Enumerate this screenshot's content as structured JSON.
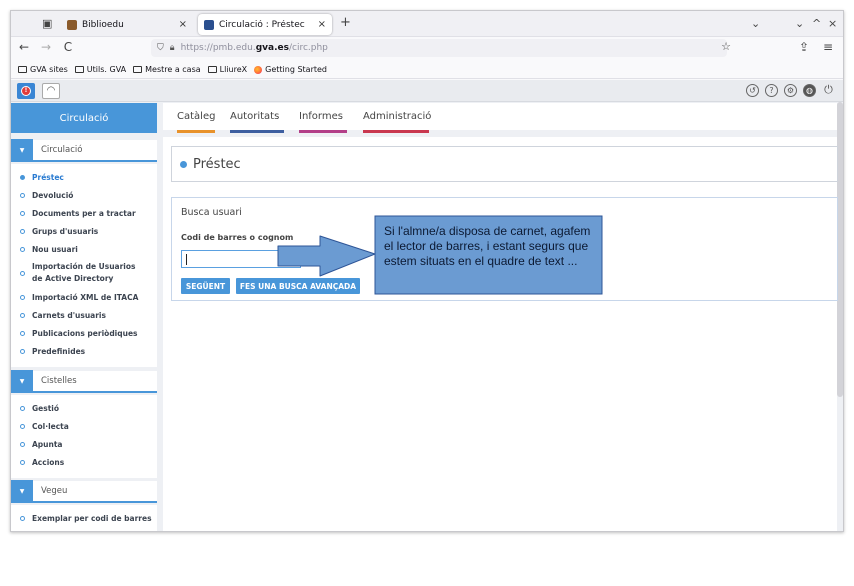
{
  "browser": {
    "tabs": [
      {
        "title": "Biblioedu",
        "close": "×"
      },
      {
        "title": "Circulació : Préstec",
        "close": "×"
      }
    ],
    "new_tab": "+",
    "window_controls": [
      "⌄",
      "⌄",
      "^",
      "×"
    ],
    "nav": {
      "back": "←",
      "forward": "→",
      "reload": "C"
    },
    "url": {
      "prefix": "https://pmb.edu.",
      "domain": "gva.es",
      "path": "/circ.php"
    },
    "bookmarks": [
      "GVA sites",
      "Utils. GVA",
      "Mestre a casa",
      "LliureX",
      "Getting Started"
    ]
  },
  "toolbar": {
    "alert_badge": "!",
    "right_icons": [
      "history-icon",
      "help-icon",
      "gear-icon",
      "globe-icon",
      "power-icon"
    ]
  },
  "sidebar": {
    "title": "Circulació",
    "sections": [
      {
        "header": "Circulació",
        "items": [
          {
            "label": "Préstec",
            "active": true
          },
          {
            "label": "Devolució"
          },
          {
            "label": "Documents per a tractar"
          },
          {
            "label": "Grups d'usuaris"
          },
          {
            "label": "Nou usuari"
          },
          {
            "label": "Importación de Usuarios de Active Directory"
          },
          {
            "label": "Importació XML de ITACA"
          },
          {
            "label": "Carnets d'usuaris"
          },
          {
            "label": "Publicacions periòdiques"
          },
          {
            "label": "Predefinides"
          }
        ]
      },
      {
        "header": "Cistelles",
        "items": [
          {
            "label": "Gestió"
          },
          {
            "label": "Col·lecta"
          },
          {
            "label": "Apunta"
          },
          {
            "label": "Accions"
          }
        ]
      },
      {
        "header": "Vegeu",
        "items": [
          {
            "label": "Exemplar per codi de barres"
          }
        ]
      }
    ]
  },
  "main": {
    "tabs": [
      {
        "label": "Catàleg",
        "color": "#e8922b"
      },
      {
        "label": "Autoritats",
        "color": "#3e5fa0"
      },
      {
        "label": "Informes",
        "color": "#b33f88"
      },
      {
        "label": "Administració",
        "color": "#c9384f"
      }
    ],
    "title": "Préstec",
    "search": {
      "heading": "Busca usuari",
      "field_label": "Codi de barres o cognom",
      "value": "",
      "next_button": "SEGÜENT",
      "advanced_button": "FES UNA BUSCA AVANÇADA"
    }
  },
  "callout": {
    "text": "Si l'almne/a disposa de carnet, agafem el lector de barres, i estant segurs que estem situats en el quadre de text ..."
  },
  "colors": {
    "accent": "#4896d9",
    "callout_fill": "#6b9bd2",
    "callout_border": "#2e5597"
  }
}
